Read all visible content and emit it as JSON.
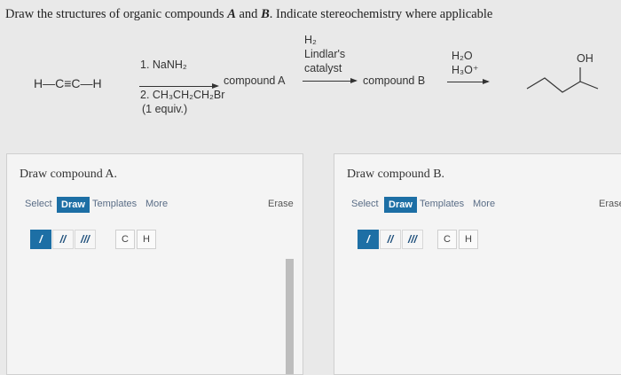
{
  "question": {
    "part1": "Draw the structures of organic compounds ",
    "A": "A",
    "and": " and ",
    "B": "B",
    "part2": ". Indicate stereochemistry where applicable"
  },
  "scheme": {
    "start": "H—C≡C—H",
    "step1_line1": "1. NaNH₂",
    "step1_line2": "2. CH₃CH₂CH₂Br",
    "step1_line3": "(1 equiv.)",
    "product1": "compound A",
    "step2_line1": "H₂",
    "step2_line2": "Lindlar's",
    "step2_line3": "catalyst",
    "product2": "compound B",
    "step3_line1": "H₂O",
    "step3_line2": "H₃O⁺",
    "final_oh": "OH"
  },
  "panelA": {
    "title": "Draw compound A.",
    "select": "Select",
    "draw": "Draw",
    "templates": "Templates",
    "more": "More",
    "erase": "Erase",
    "atom_c": "C",
    "atom_h": "H"
  },
  "panelB": {
    "title": "Draw compound B.",
    "select": "Select",
    "draw": "Draw",
    "templates": "Templates",
    "more": "More",
    "erase": "Erase",
    "atom_c": "C",
    "atom_h": "H"
  },
  "colors": {
    "accent": "#1d6fa5",
    "panel_bg": "#f4f4f4",
    "page_bg": "#e9e9e9"
  }
}
